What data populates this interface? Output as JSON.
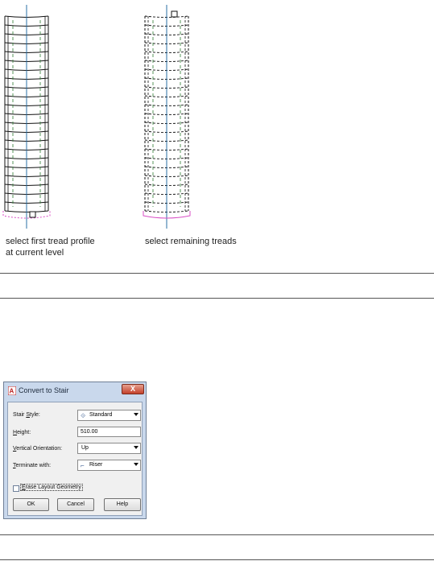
{
  "captions": {
    "left_line1": "select first tread profile",
    "left_line2": "at current level",
    "right": "select remaining treads"
  },
  "dialog": {
    "title": "Convert to Stair",
    "close_label": "X",
    "fields": {
      "stair_style": {
        "label_pre": "Stair ",
        "label_key": "S",
        "label_post": "tyle:",
        "value": "Standard"
      },
      "height": {
        "label_key": "H",
        "label_post": "eight:",
        "value": "510.00"
      },
      "vertical_orientation": {
        "label_key": "V",
        "label_post": "ertical Orientation:",
        "value": "Up"
      },
      "terminate_with": {
        "label_key": "T",
        "label_post": "erminate with:",
        "value": "Riser"
      }
    },
    "erase_layout": {
      "label_key": "E",
      "label_post": "rase Layout Geometry",
      "checked": false
    },
    "buttons": {
      "ok": "OK",
      "cancel": "Cancel",
      "help": "Help"
    }
  },
  "colors": {
    "axis": "#2a6fa5",
    "tread_dash": "#2e7d32",
    "profile_pink": "#d94fc6",
    "dialog_frame": "#c9d8ec"
  }
}
